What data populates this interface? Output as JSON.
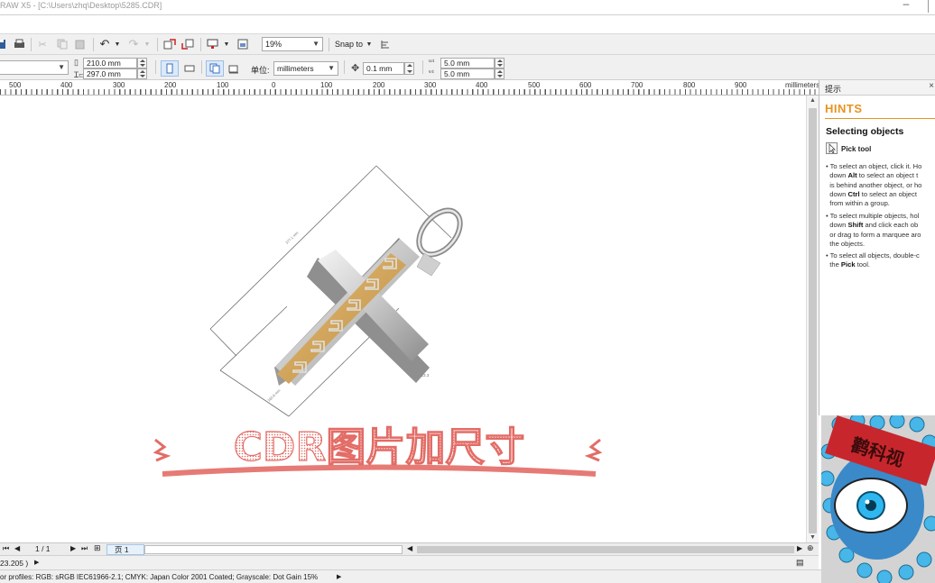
{
  "window": {
    "title": "RAW X5 - [C:\\Users\\zhq\\Desktop\\5285.CDR]"
  },
  "toolbar": {
    "zoom_value": "19%",
    "snap_label": "Snap to"
  },
  "property_bar": {
    "paper_width": "210.0 mm",
    "paper_height": "297.0 mm",
    "units_label": "单位:",
    "units_value": "millimeters",
    "nudge_value": "0.1 mm",
    "dup_x": "5.0 mm",
    "dup_y": "5.0 mm"
  },
  "ruler": {
    "labels": [
      "500",
      "400",
      "300",
      "200",
      "100",
      "0",
      "100",
      "200",
      "300",
      "400",
      "500",
      "600",
      "700",
      "800",
      "900",
      "millimeters"
    ]
  },
  "canvas": {
    "dim_long": "377.1 mm",
    "dim_short": "165.6 mm",
    "dim_height": "213.3",
    "banner_text": "CDR图片加尺寸"
  },
  "page_nav": {
    "page_count": "1 / 1",
    "page_tab": "页 1"
  },
  "status": {
    "coords": "23.205 )",
    "color_profiles": "or profiles: RGB: sRGB IEC61966-2.1; CMYK: Japan Color 2001 Coated; Grayscale: Dot Gain 15%"
  },
  "docker": {
    "tab_label": "提示",
    "hints_title": "HINTS",
    "heading": "Selecting objects",
    "tool_name": "Pick tool",
    "p1": [
      "To select an object, click it. Ho",
      "down",
      "Alt",
      "to select an object t",
      "is behind another object, or ho",
      "down",
      "Ctrl",
      "to select an object",
      "from within a group."
    ],
    "p2": [
      "To select multiple objects, hol",
      "down",
      "Shift",
      "and click each ob",
      "or drag to form a marquee aro",
      "the objects."
    ],
    "p3": [
      "To select all objects, double-c",
      "the",
      "Pick",
      "tool."
    ]
  },
  "overlay": {
    "badge_text": "鹳科视"
  }
}
